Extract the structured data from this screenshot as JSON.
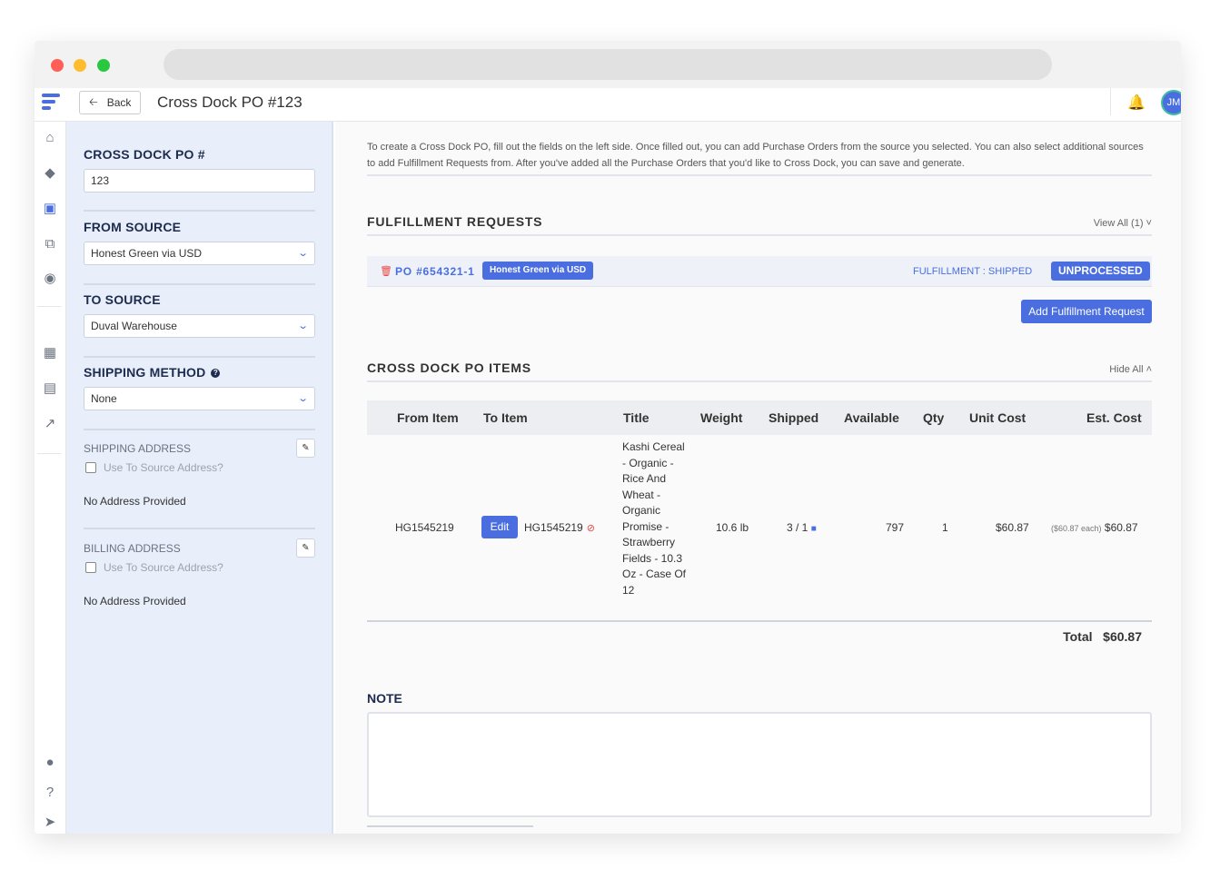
{
  "header": {
    "back_label": "Back",
    "page_title": "Cross Dock PO #123",
    "avatar_initials": "JM"
  },
  "left": {
    "po_label": "CROSS DOCK PO #",
    "po_value": "123",
    "from_label": "FROM SOURCE",
    "from_value": "Honest Green via USD",
    "to_label": "TO SOURCE",
    "to_value": "Duval Warehouse",
    "shipping_label": "SHIPPING METHOD",
    "shipping_value": "None",
    "ship_addr_label": "SHIPPING ADDRESS",
    "ship_use_to": "Use To Source Address?",
    "ship_no_addr": "No Address Provided",
    "bill_addr_label": "BILLING ADDRESS",
    "bill_use_to": "Use To Source Address?",
    "bill_no_addr": "No Address Provided"
  },
  "main": {
    "intro": "To create a Cross Dock PO, fill out the fields on the left side. Once filled out, you can add Purchase Orders from the source you selected. You can also select additional sources to add Fulfillment Requests from. After you've added all the Purchase Orders that you'd like to Cross Dock, you can save and generate.",
    "fr_title": "FULFILLMENT REQUESTS",
    "fr_view_all": "View All (1) ˅",
    "fr_po": "PO #654321-1",
    "fr_badge": "Honest Green via USD",
    "fr_status": "FULFILLMENT : SHIPPED",
    "fr_unprocessed": "UNPROCESSED",
    "add_fr_button": "Add Fulfillment Request",
    "items_title": "CROSS DOCK PO ITEMS",
    "items_hide_all": "Hide All ˄",
    "columns": [
      "From Item",
      "To Item",
      "Title",
      "Weight",
      "Shipped",
      "Available",
      "Qty",
      "Unit Cost",
      "Est. Cost"
    ],
    "row": {
      "from_item": "HG1545219",
      "edit_label": "Edit",
      "to_item": "HG1545219",
      "title": "Kashi Cereal - Organic - Rice And Wheat - Organic Promise - Strawberry Fields - 10.3 Oz - Case Of 12",
      "weight": "10.6 lb",
      "shipped": "3 / 1",
      "available": "797",
      "qty": "1",
      "unit_cost": "$60.87",
      "each": "($60.87 each)",
      "est_cost": "$60.87"
    },
    "total_label": "Total",
    "total_value": "$60.87",
    "note_label": "NOTE"
  },
  "colors": {
    "accent": "#4a6ee0",
    "panel_bg": "#e8eefa",
    "danger": "#e84545"
  },
  "icons": [
    "home-icon",
    "tag-icon",
    "inbox-icon",
    "copy-icon",
    "users-icon",
    "building-icon",
    "cart-icon",
    "chart-icon",
    "chat-icon",
    "help-icon",
    "rocket-icon",
    "bell-icon",
    "trash-icon",
    "unlink-icon",
    "truck-icon",
    "pencil-icon",
    "chevron-down-icon",
    "arrow-left-icon"
  ]
}
